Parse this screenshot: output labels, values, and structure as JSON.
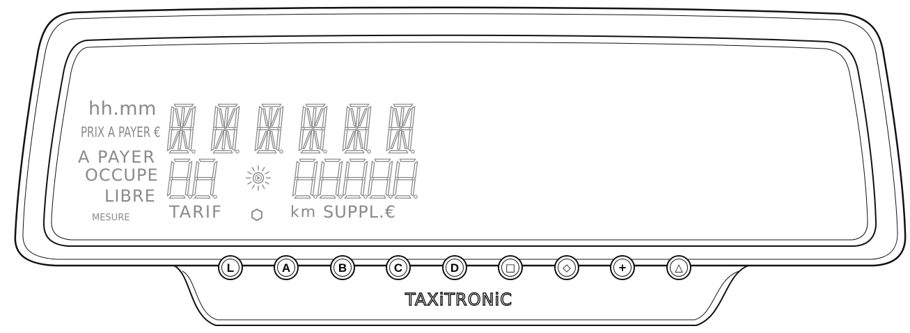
{
  "labels": {
    "hhmm": "hh.mm",
    "prix": "PRIX A PAYER €",
    "apayer": "A PAYER",
    "occupe": "OCCUPE",
    "libre": "LIBRE",
    "mesure": "MESURE",
    "tarif": "TARIF",
    "km": "km",
    "suppl": "SUPPL.€"
  },
  "buttons": [
    {
      "label": "L"
    },
    {
      "label": "A"
    },
    {
      "label": "B"
    },
    {
      "label": "C"
    },
    {
      "label": "D"
    },
    {
      "icon": "square-icon",
      "glyph": "□"
    },
    {
      "icon": "diamond-icon",
      "glyph": "◇"
    },
    {
      "icon": "plus-icon",
      "glyph": "+"
    },
    {
      "icon": "triangle-icon",
      "glyph": "△"
    }
  ],
  "brand": "TAXiTRONiC",
  "colors": {
    "outline": "#111111",
    "segment": "#8a8a8a",
    "label": "#8a8a8a"
  }
}
